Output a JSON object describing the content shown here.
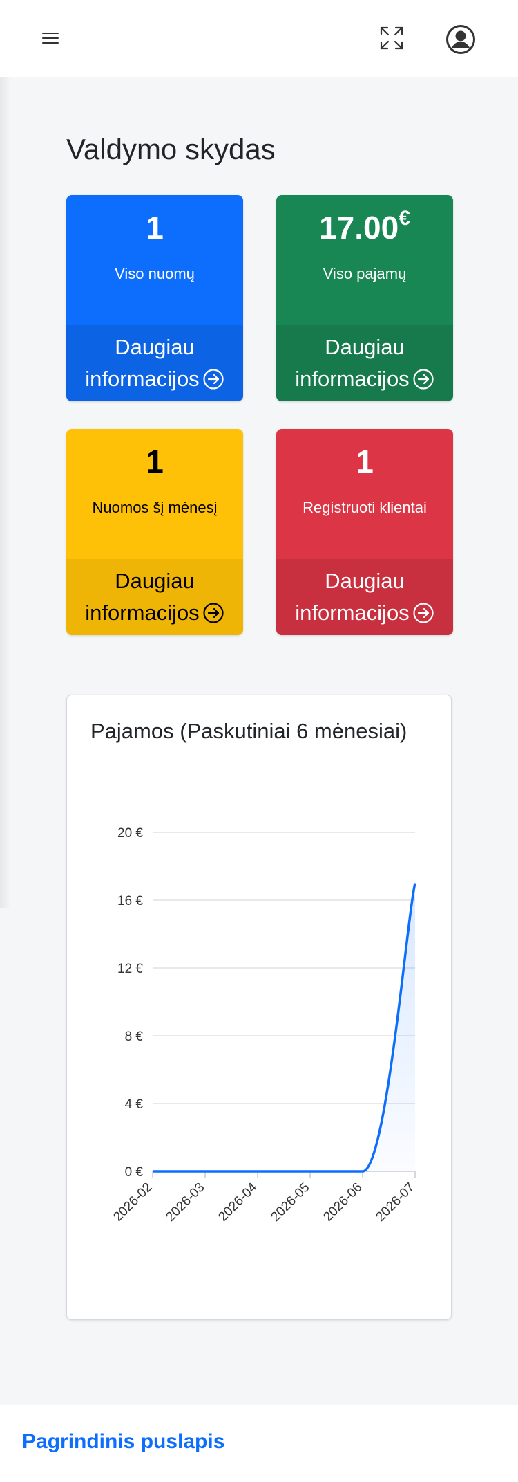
{
  "header": {
    "menu_icon": "hamburger-icon",
    "expand_icon": "fullscreen-expand-icon",
    "avatar_icon": "user-circle-icon"
  },
  "page": {
    "title": "Valdymo skydas"
  },
  "cards": [
    {
      "value": "1",
      "label": "Viso nuomų",
      "more": "Daugiau informacijos",
      "color": "#0d6efd"
    },
    {
      "value": "17.00",
      "suffix": "€",
      "label": "Viso pajamų",
      "more": "Daugiau informacijos",
      "color": "#198754"
    },
    {
      "value": "1",
      "label": "Nuomos šį mėnesį",
      "more": "Daugiau informacijos",
      "color": "#ffc107"
    },
    {
      "value": "1",
      "label": "Registruoti klientai",
      "more": "Daugiau informacijos",
      "color": "#dc3545"
    }
  ],
  "chart_data": {
    "type": "line",
    "title": "Pajamos (Paskutiniai 6 mėnesiai)",
    "categories": [
      "2026-02",
      "2026-03",
      "2026-04",
      "2026-05",
      "2026-06",
      "2026-07"
    ],
    "values": [
      0,
      0,
      0,
      0,
      0,
      17
    ],
    "yticks": [
      "0 €",
      "4 €",
      "8 €",
      "12 €",
      "16 €",
      "20 €"
    ],
    "ylim": [
      0,
      20
    ],
    "grid": true,
    "color": "#0d6efd"
  },
  "footer": {
    "home_link": "Pagrindinis puslapis"
  }
}
